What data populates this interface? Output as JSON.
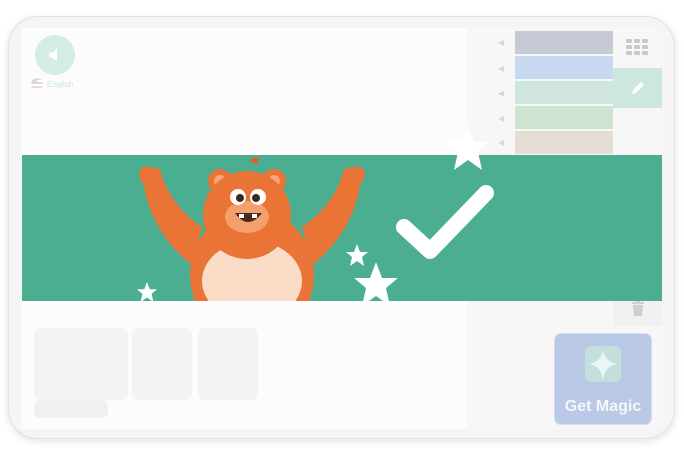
{
  "toolbar": {
    "language_label": "English",
    "magic_label": "Get Magic"
  },
  "palette": {
    "swatches": [
      "#c6cad4",
      "#c7d9f1",
      "#cfe6df",
      "#cfe3d3",
      "#e5ddd3"
    ]
  },
  "colors": {
    "banner": "#4cae91",
    "bear_body": "#e97436",
    "bear_belly": "#fbdcc7"
  },
  "icons": {
    "speaker": "speaker-icon",
    "grid": "grid-icon",
    "pencil": "pencil-icon",
    "trash": "trash-icon",
    "check": "check-icon",
    "magic": "magic-sparkle-icon"
  }
}
